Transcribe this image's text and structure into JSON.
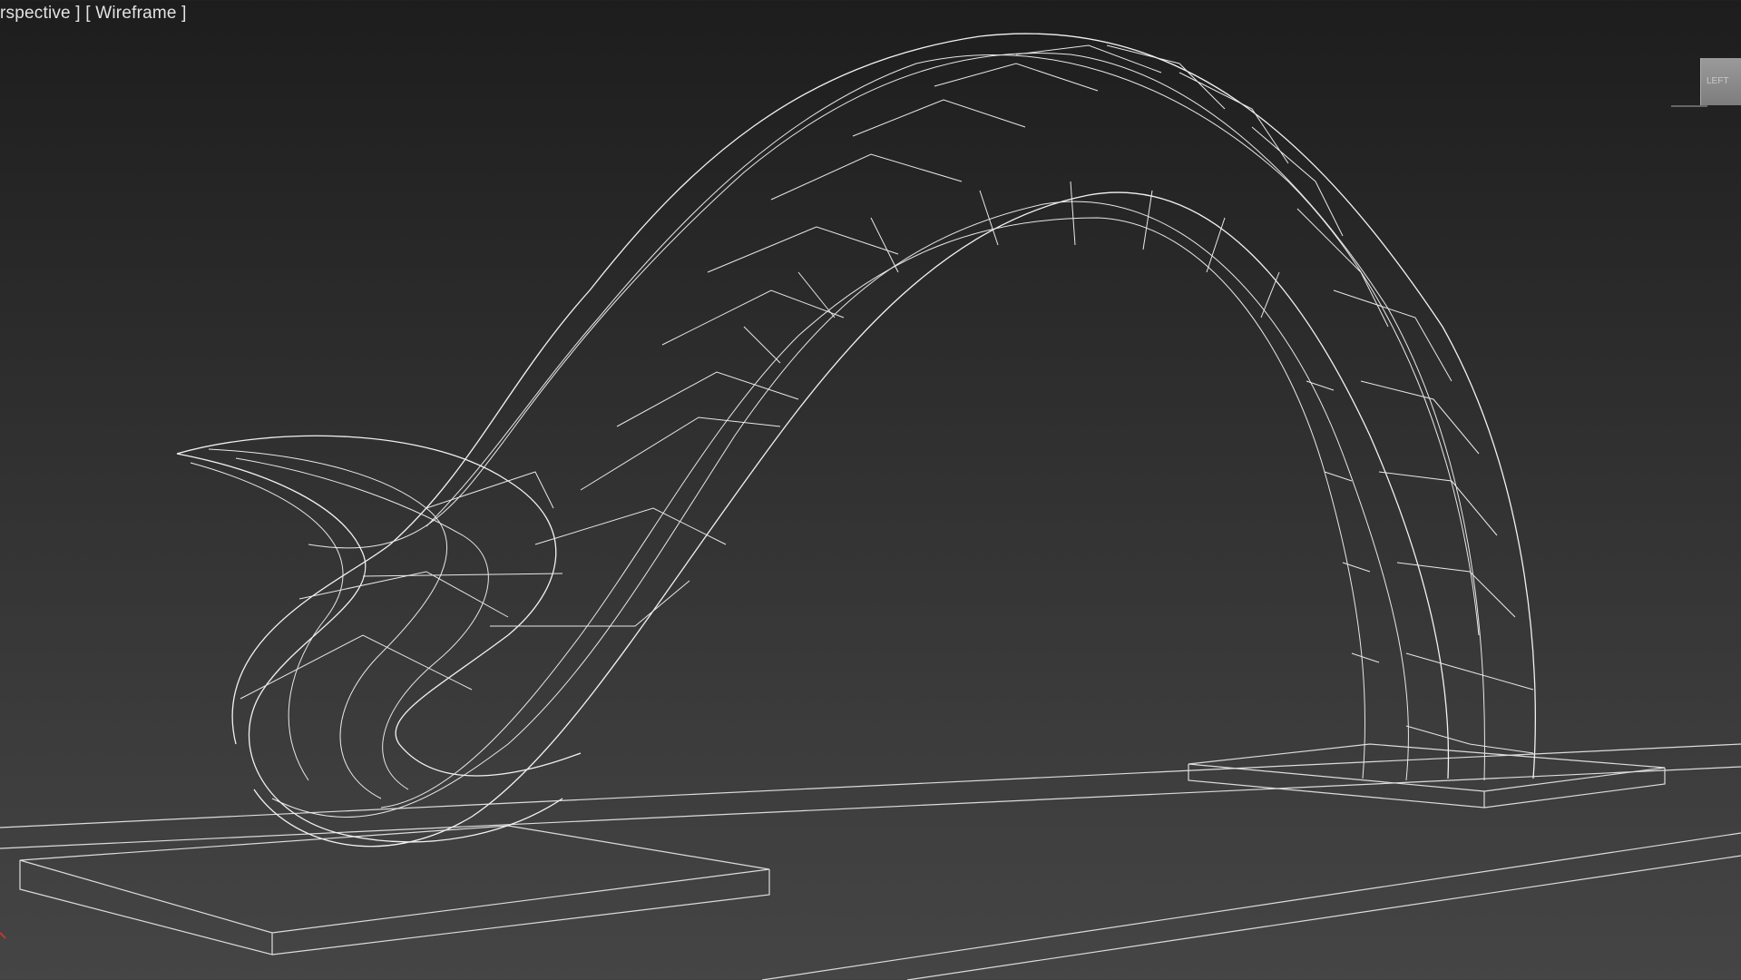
{
  "viewport": {
    "view_label": "rspective ]",
    "shading_label": "[ Wireframe ]"
  },
  "viewcube": {
    "face_label": "LEFT"
  },
  "colors": {
    "background_top": "#1d1d1d",
    "background_bottom": "#454545",
    "wireframe": "#f2f2f2",
    "axis_x": "#c0392b"
  },
  "icons": {
    "viewcube": "viewcube-icon",
    "axis_tripod": "axis-tripod-icon"
  }
}
